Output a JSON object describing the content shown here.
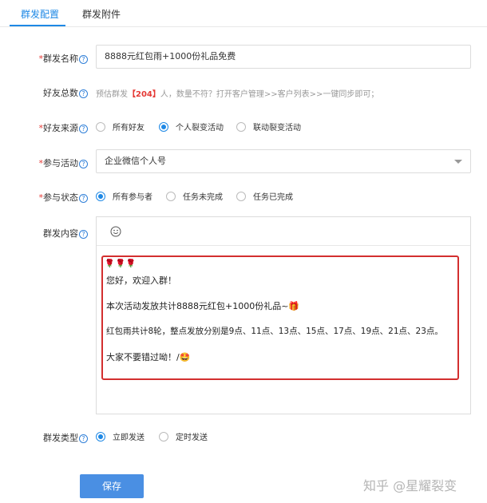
{
  "tabs": [
    {
      "label": "群发配置",
      "active": true
    },
    {
      "label": "群发附件",
      "active": false
    }
  ],
  "form": {
    "name": {
      "label": "群发名称",
      "required": "*",
      "value": "8888元红包雨+1000份礼品免费"
    },
    "friends_total": {
      "label": "好友总数",
      "hint_prefix": "预估群发",
      "count": "【204】",
      "hint_suffix": "人，数量不符？打开客户管理>>客户列表>>一键同步即可；"
    },
    "friend_source": {
      "label": "好友来源",
      "required": "*",
      "options": [
        {
          "label": "所有好友",
          "selected": false
        },
        {
          "label": "个人裂变活动",
          "selected": true
        },
        {
          "label": "联动裂变活动",
          "selected": false
        }
      ]
    },
    "activity": {
      "label": "参与活动",
      "required": "*",
      "value": "企业微信个人号"
    },
    "status": {
      "label": "参与状态",
      "required": "*",
      "options": [
        {
          "label": "所有参与者",
          "selected": true
        },
        {
          "label": "任务未完成",
          "selected": false
        },
        {
          "label": "任务已完成",
          "selected": false
        }
      ]
    },
    "content": {
      "label": "群发内容",
      "toolbar_icon": "smiley-icon",
      "decoration": "🌹🌹🌹",
      "lines": [
        "您好，欢迎入群！",
        "本次活动发放共计8888元红包+1000份礼品~🎁",
        "红包雨共计8轮，整点发放分别是9点、11点、13点、15点、17点、19点、21点、23点。",
        "大家不要错过呦！/🤩"
      ]
    },
    "send_type": {
      "label": "群发类型",
      "options": [
        {
          "label": "立即发送",
          "selected": true
        },
        {
          "label": "定时发送",
          "selected": false
        }
      ]
    }
  },
  "actions": {
    "save_label": "保存"
  },
  "watermark": "知乎 @星耀裂变",
  "colors": {
    "accent": "#1e88e5",
    "required": "#e53935",
    "button": "#4a8fe3",
    "highlight_border": "#d32f2f"
  }
}
